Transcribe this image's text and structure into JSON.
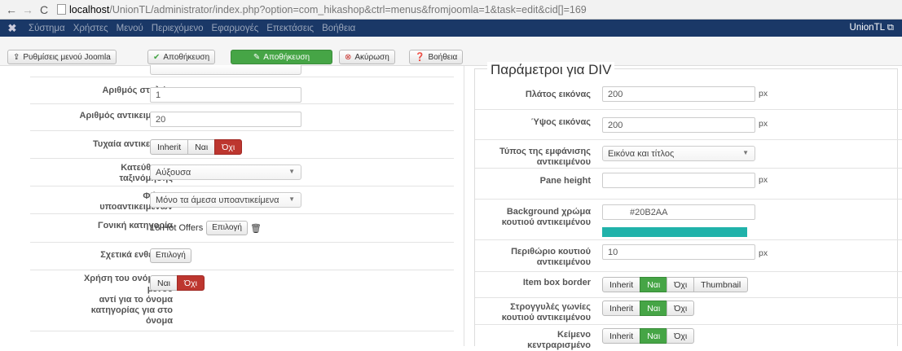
{
  "browser": {
    "url_host": "localhost",
    "url_rest": "/UnionTL/administrator/index.php?option=com_hikashop&ctrl=menus&fromjoomla=1&task=edit&cid[]=169"
  },
  "admin_nav": {
    "items": [
      "Σύστημα",
      "Χρήστες",
      "Μενού",
      "Περιεχόμενο",
      "Εφαρμογές",
      "Επεκτάσεις",
      "Βοήθεια"
    ],
    "site_name": "UnionTL"
  },
  "toolbar": {
    "joomla_menu_settings": "Ρυθμίσεις μενού Joomla",
    "save": "Αποθήκευση",
    "save_close": "Αποθήκευση",
    "cancel": "Ακύρωση",
    "help": "Βοήθεια"
  },
  "left": {
    "columns_label": "Αριθμός στηλών",
    "columns_value": "1",
    "items_label": "Αριθμός αντικειμένων",
    "items_value": "20",
    "random_label": "Τυχαία αντικείμενα",
    "random_options": [
      "Inherit",
      "Ναι",
      "Όχι"
    ],
    "random_selected": "Όχι",
    "sort_label_1": "Κατεύθυνση",
    "sort_label_2": "ταξινόμησης",
    "sort_value": "Αύξουσα",
    "filter_label_1": "Φίλτρο",
    "filter_label_2": "υποαντικειμένων",
    "filter_value": "Μόνο τα άμεσα υποαντικείμενα",
    "parent_label": "Γονική κατηγορία",
    "parent_value": "16 Hot Offers",
    "parent_button": "Επιλογή",
    "related_label": "Σχετικά ενθέματα",
    "related_button": "Επιλογή",
    "use_menu_label_1": "Χρήση του ονόματος",
    "use_menu_label_2": "μενού",
    "use_menu_label_3": "αντί για το όνομα",
    "use_menu_label_4": "κατηγορίας για στο",
    "use_menu_label_5": "όνομα",
    "use_menu_options": [
      "Ναι",
      "Όχι"
    ],
    "use_menu_selected": "Όχι"
  },
  "right": {
    "legend": "Παράμετροι για DIV",
    "width_label": "Πλάτος εικόνας",
    "width_value": "200",
    "height_label": "Ύψος εικόνας",
    "height_value": "200",
    "unit_px": "px",
    "display_label_1": "Τύπος της εμφάνισης",
    "display_label_2": "αντικειμένου",
    "display_value": "Εικόνα και τίτλος",
    "pane_label": "Pane height",
    "pane_value": "",
    "bg_label_1": "Background χρώμα",
    "bg_label_2": "κουτιού αντικειμένου",
    "bg_value": "#20B2AA",
    "margin_label_1": "Περιθώριο κουτιού",
    "margin_label_2": "αντικειμένου",
    "margin_value": "10",
    "border_label": "Item box border",
    "border_options": [
      "Inherit",
      "Ναι",
      "Όχι",
      "Thumbnail"
    ],
    "border_selected": "Ναι",
    "rounded_label_1": "Στρογγυλές γωνίες",
    "rounded_label_2": "κουτιού αντικειμένου",
    "rounded_options": [
      "Inherit",
      "Ναι",
      "Όχι"
    ],
    "rounded_selected": "Ναι",
    "center_label_1": "Κείμενο",
    "center_label_2": "κεντραρισμένο",
    "center_options": [
      "Inherit",
      "Ναι",
      "Όχι"
    ],
    "center_selected": "Ναι"
  },
  "colors": {
    "admin_nav_bg": "#1a3867",
    "green": "#46a546",
    "red": "#bd362f",
    "swatch": "#20B2AA"
  }
}
